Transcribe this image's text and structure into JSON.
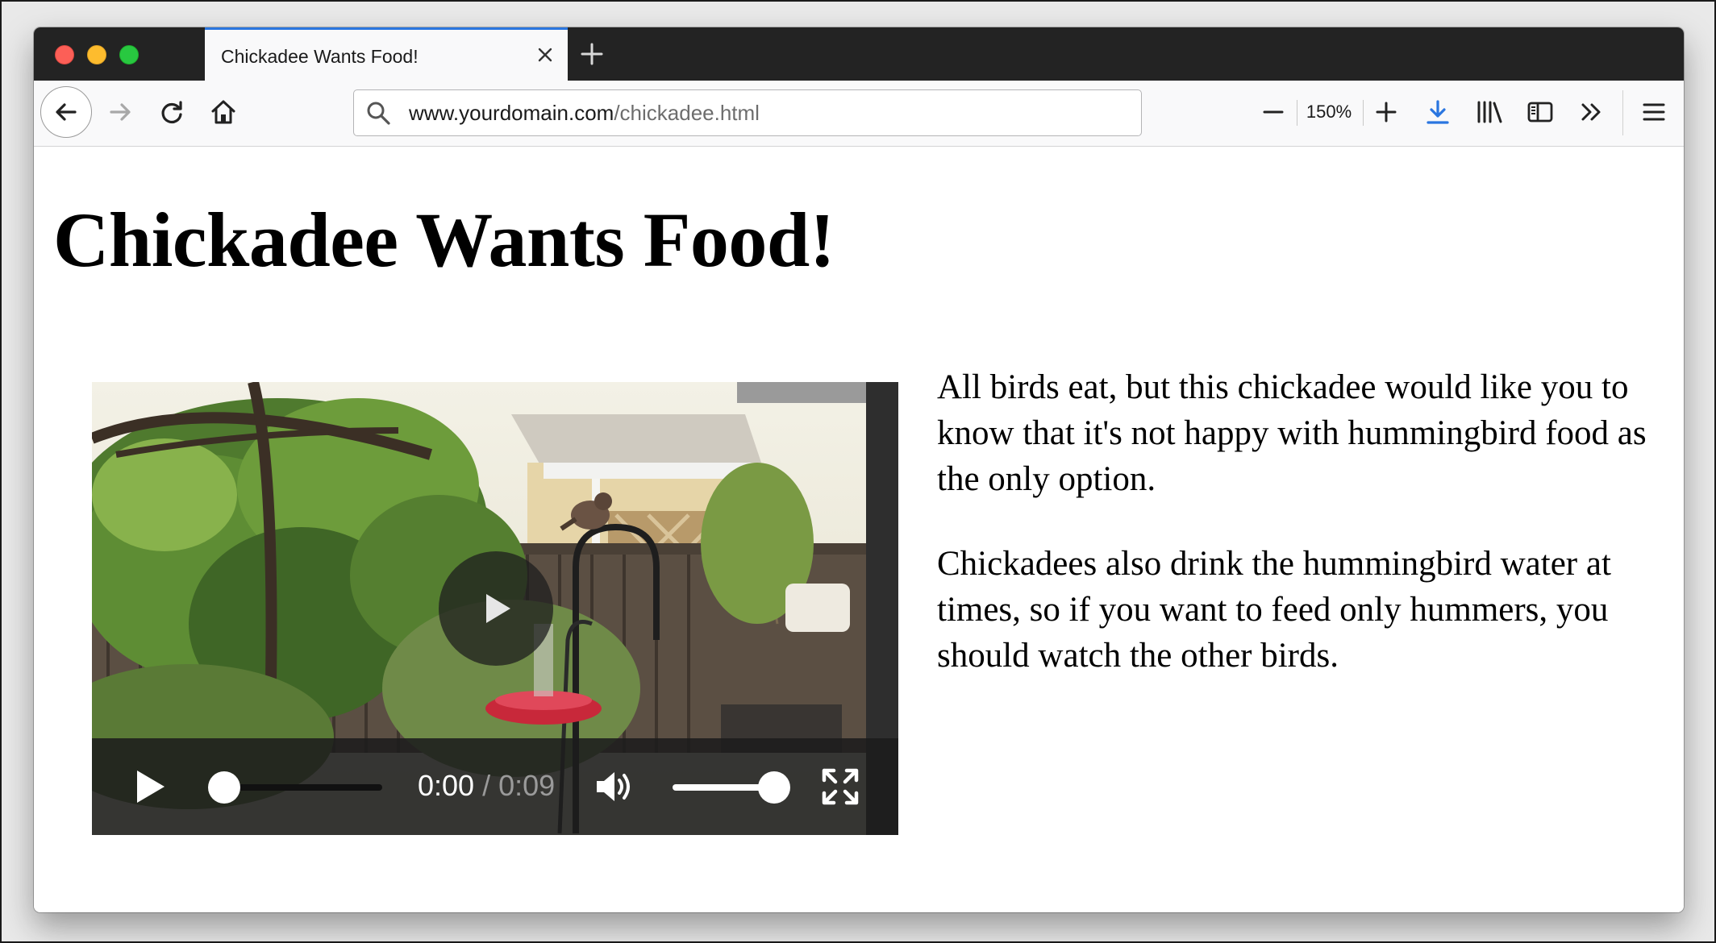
{
  "tab": {
    "title": "Chickadee Wants Food!"
  },
  "url": {
    "domain": "www.yourdomain.com",
    "path": "/chickadee.html"
  },
  "toolbar": {
    "zoom_level": "150%"
  },
  "page": {
    "heading": "Chickadee Wants Food!",
    "paragraphs": [
      "All birds eat, but this chickadee would like you to know that it's not happy with hummingbird food as the only option.",
      "Chickadees also drink the hummingbird water at times, so if you want to feed only hummers, you should watch the other birds."
    ]
  },
  "video": {
    "current_time": "0:00",
    "separator": " / ",
    "duration": "0:09",
    "progress": 0,
    "volume": 1
  },
  "colors": {
    "tab_accent": "#2a76e0",
    "download_icon": "#2a76e0",
    "close_button": "#fc5f57",
    "minimize_button": "#fdbc2e",
    "maximize_button": "#28c840"
  },
  "icons": [
    "back-arrow-icon",
    "forward-arrow-icon",
    "reload-icon",
    "home-icon",
    "search-icon",
    "minus-icon",
    "plus-icon",
    "download-icon",
    "library-icon",
    "sidebar-icon",
    "overflow-chevrons-icon",
    "hamburger-menu-icon",
    "play-icon",
    "speaker-icon",
    "fullscreen-icon",
    "close-icon"
  ]
}
